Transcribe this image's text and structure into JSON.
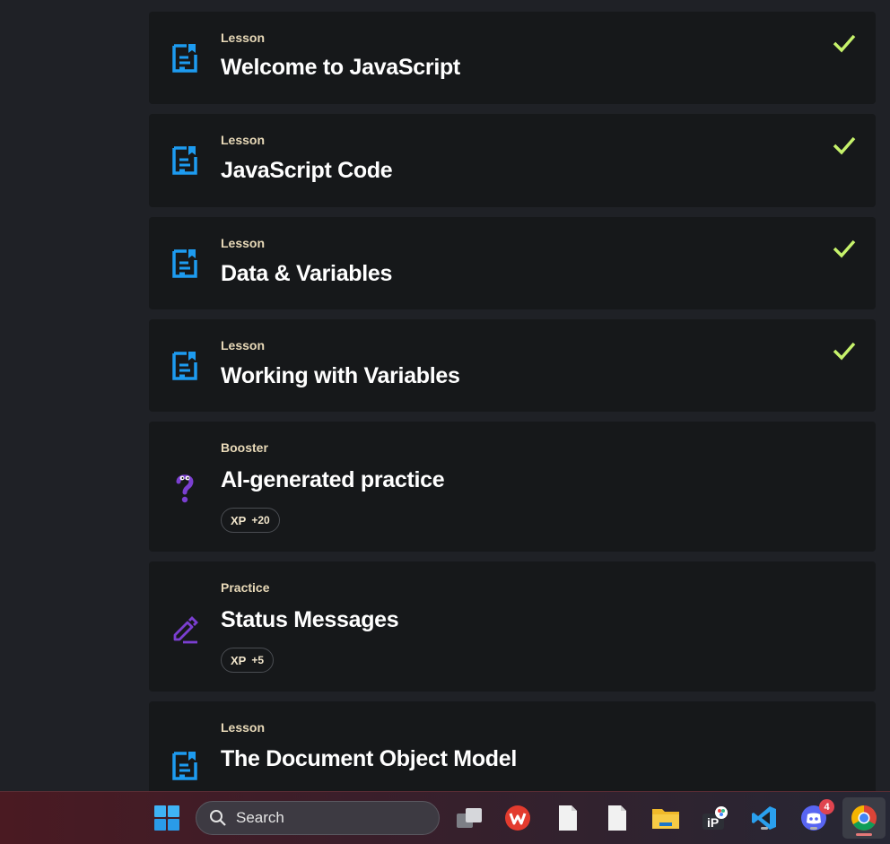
{
  "lessons": [
    {
      "type": "Lesson",
      "title": "Welcome to JavaScript",
      "completed": true
    },
    {
      "type": "Lesson",
      "title": "JavaScript Code",
      "completed": true
    },
    {
      "type": "Lesson",
      "title": "Data & Variables",
      "completed": true
    },
    {
      "type": "Lesson",
      "title": "Working with Variables",
      "completed": true
    },
    {
      "type": "Booster",
      "title": "AI-generated practice",
      "xp_label": "XP",
      "xp_value": "+20"
    },
    {
      "type": "Practice",
      "title": "Status Messages",
      "xp_label": "XP",
      "xp_value": "+5"
    },
    {
      "type": "Lesson",
      "title": "The Document Object Model"
    }
  ],
  "taskbar": {
    "search_placeholder": "Search",
    "discord_badge": "4"
  },
  "colors": {
    "lesson_icon": "#1d9bf0",
    "check": "#c6f26b",
    "booster_icon": "#7b3fd1",
    "practice_icon": "#7b3fd1"
  }
}
